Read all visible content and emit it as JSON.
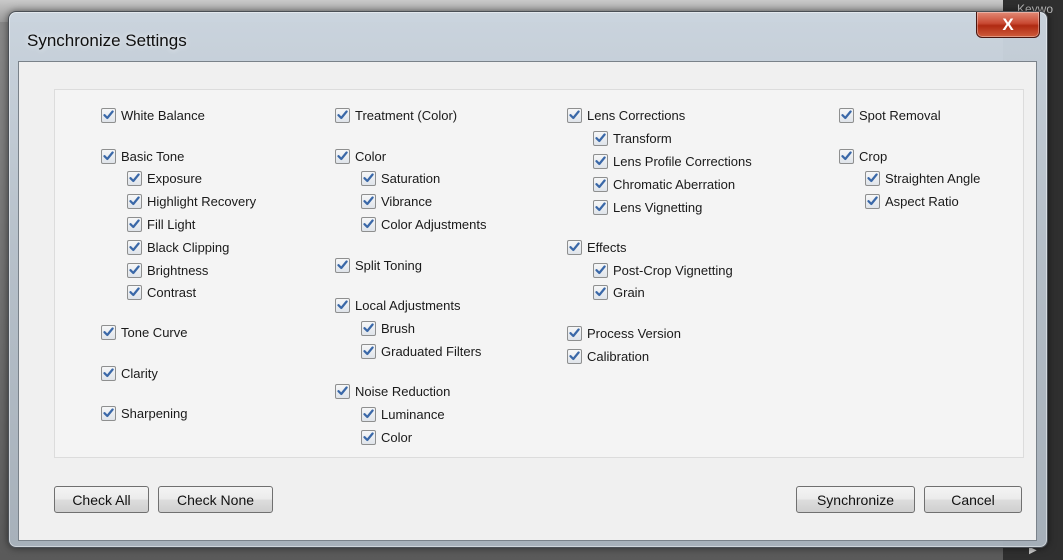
{
  "background": {
    "keyword_label": "Keywo"
  },
  "dialog": {
    "title": "Synchronize Settings",
    "close_label": "X",
    "columns": [
      {
        "items": [
          {
            "label": "White Balance",
            "checked": true,
            "indent": 0
          },
          {
            "label": "Basic Tone",
            "checked": true,
            "indent": 0
          },
          {
            "label": "Exposure",
            "checked": true,
            "indent": 1
          },
          {
            "label": "Highlight Recovery",
            "checked": true,
            "indent": 1
          },
          {
            "label": "Fill Light",
            "checked": true,
            "indent": 1
          },
          {
            "label": "Black Clipping",
            "checked": true,
            "indent": 1
          },
          {
            "label": "Brightness",
            "checked": true,
            "indent": 1
          },
          {
            "label": "Contrast",
            "checked": true,
            "indent": 1
          },
          {
            "label": "Tone Curve",
            "checked": true,
            "indent": 0
          },
          {
            "label": "Clarity",
            "checked": true,
            "indent": 0
          },
          {
            "label": "Sharpening",
            "checked": true,
            "indent": 0
          }
        ]
      },
      {
        "items": [
          {
            "label": "Treatment (Color)",
            "checked": true,
            "indent": 0
          },
          {
            "label": "Color",
            "checked": true,
            "indent": 0
          },
          {
            "label": "Saturation",
            "checked": true,
            "indent": 1
          },
          {
            "label": "Vibrance",
            "checked": true,
            "indent": 1
          },
          {
            "label": "Color Adjustments",
            "checked": true,
            "indent": 1
          },
          {
            "label": "Split Toning",
            "checked": true,
            "indent": 0
          },
          {
            "label": "Local Adjustments",
            "checked": true,
            "indent": 0
          },
          {
            "label": "Brush",
            "checked": true,
            "indent": 1
          },
          {
            "label": "Graduated Filters",
            "checked": true,
            "indent": 1
          },
          {
            "label": "Noise Reduction",
            "checked": true,
            "indent": 0
          },
          {
            "label": "Luminance",
            "checked": true,
            "indent": 1
          },
          {
            "label": "Color",
            "checked": true,
            "indent": 1
          }
        ]
      },
      {
        "items": [
          {
            "label": "Lens Corrections",
            "checked": true,
            "indent": 0
          },
          {
            "label": "Transform",
            "checked": true,
            "indent": 1
          },
          {
            "label": "Lens Profile Corrections",
            "checked": true,
            "indent": 1
          },
          {
            "label": "Chromatic Aberration",
            "checked": true,
            "indent": 1
          },
          {
            "label": "Lens Vignetting",
            "checked": true,
            "indent": 1
          },
          {
            "label": "Effects",
            "checked": true,
            "indent": 0
          },
          {
            "label": "Post-Crop Vignetting",
            "checked": true,
            "indent": 1
          },
          {
            "label": "Grain",
            "checked": true,
            "indent": 1
          },
          {
            "label": "Process Version",
            "checked": true,
            "indent": 0
          },
          {
            "label": "Calibration",
            "checked": true,
            "indent": 0
          }
        ]
      },
      {
        "items": [
          {
            "label": "Spot Removal",
            "checked": true,
            "indent": 0
          },
          {
            "label": "Crop",
            "checked": true,
            "indent": 0
          },
          {
            "label": "Straighten Angle",
            "checked": true,
            "indent": 1
          },
          {
            "label": "Aspect Ratio",
            "checked": true,
            "indent": 1
          }
        ]
      }
    ],
    "buttons": {
      "check_all": "Check All",
      "check_none": "Check None",
      "synchronize": "Synchronize",
      "cancel": "Cancel"
    },
    "colors": {
      "check_mark": "#3a68a8",
      "close_button": "#c94a33"
    }
  }
}
